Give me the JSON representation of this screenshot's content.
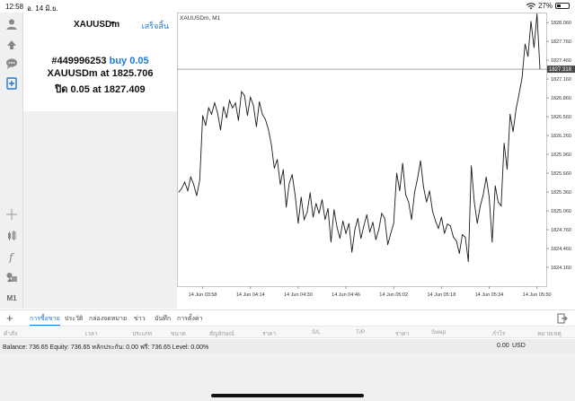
{
  "status_bar": {
    "time": "12:58",
    "date": "อ. 14 มิ.ย.",
    "battery": "27%",
    "battery_level": 0.27
  },
  "toolbar": {
    "icons": [
      "account-icon",
      "trade-icon",
      "chat-icon",
      "new-order-icon",
      "crosshair-icon",
      "indicators-icon",
      "function-icon",
      "objects-icon"
    ],
    "timeframe": "M1"
  },
  "order_panel": {
    "symbol": "XAUUSDm",
    "done_label": "เสร็จสิ้น",
    "ticket": "#449996253",
    "action": "buy 0.05",
    "opened_prefix": "XAUUSDm at",
    "open_price": "1825.706",
    "close_prefix": "ปิด 0.05 at",
    "close_price": "1827.409"
  },
  "chart": {
    "title": "XAUUSDm, M1",
    "current_price": "1827.318",
    "y_labels": [
      "1828.060",
      "1827.760",
      "1827.460",
      "1827.160",
      "1826.860",
      "1826.560",
      "1826.260",
      "1825.960",
      "1825.660",
      "1825.360",
      "1825.060",
      "1824.760",
      "1824.460",
      "1824.160"
    ],
    "x_labels": [
      "14 Jun 03:58",
      "14 Jun 04:14",
      "14 Jun 04:30",
      "14 Jun 04:46",
      "14 Jun 05:02",
      "14 Jun 05:18",
      "14 Jun 05:34",
      "14 Jun 05:50"
    ],
    "line_color": "#1a1a1a",
    "price_line_color": "#8a8a8a"
  },
  "chart_data": {
    "type": "line",
    "title": "XAUUSDm, M1",
    "xlabel": "",
    "ylabel": "",
    "ylim": [
      1823.86,
      1828.22
    ],
    "grid": false,
    "x": [
      "03:50",
      "03:51",
      "03:52",
      "03:53",
      "03:54",
      "03:55",
      "03:56",
      "03:57",
      "03:58",
      "03:59",
      "04:00",
      "04:01",
      "04:02",
      "04:03",
      "04:04",
      "04:05",
      "04:06",
      "04:07",
      "04:08",
      "04:09",
      "04:10",
      "04:11",
      "04:12",
      "04:13",
      "04:14",
      "04:15",
      "04:16",
      "04:17",
      "04:18",
      "04:19",
      "04:20",
      "04:21",
      "04:22",
      "04:23",
      "04:24",
      "04:25",
      "04:26",
      "04:27",
      "04:28",
      "04:29",
      "04:30",
      "04:31",
      "04:32",
      "04:33",
      "04:34",
      "04:35",
      "04:36",
      "04:37",
      "04:38",
      "04:39",
      "04:40",
      "04:41",
      "04:42",
      "04:43",
      "04:44",
      "04:45",
      "04:46",
      "04:47",
      "04:48",
      "04:49",
      "04:50",
      "04:51",
      "04:52",
      "04:53",
      "04:54",
      "04:55",
      "04:56",
      "04:57",
      "04:58",
      "04:59",
      "05:00",
      "05:01",
      "05:02",
      "05:03",
      "05:04",
      "05:05",
      "05:06",
      "05:07",
      "05:08",
      "05:09",
      "05:10",
      "05:11",
      "05:12",
      "05:13",
      "05:14",
      "05:15",
      "05:16",
      "05:17",
      "05:18",
      "05:19",
      "05:20",
      "05:21",
      "05:22",
      "05:23",
      "05:24",
      "05:25",
      "05:26",
      "05:27",
      "05:28",
      "05:29",
      "05:30",
      "05:31",
      "05:32",
      "05:33",
      "05:34",
      "05:35",
      "05:36",
      "05:37",
      "05:38",
      "05:39",
      "05:40",
      "05:41",
      "05:42",
      "05:43",
      "05:44",
      "05:45",
      "05:46",
      "05:47",
      "05:48",
      "05:49",
      "05:50",
      "05:51"
    ],
    "series": [
      {
        "values": [
          1825.36,
          1825.42,
          1825.52,
          1825.38,
          1825.6,
          1825.48,
          1825.3,
          1825.55,
          1826.58,
          1826.42,
          1826.7,
          1826.6,
          1826.78,
          1826.62,
          1826.35,
          1826.72,
          1826.54,
          1826.82,
          1826.7,
          1826.78,
          1826.5,
          1826.96,
          1826.9,
          1826.58,
          1826.87,
          1826.74,
          1826.4,
          1826.8,
          1826.6,
          1826.52,
          1826.36,
          1826.12,
          1825.74,
          1825.88,
          1825.48,
          1825.72,
          1825.12,
          1825.5,
          1825.64,
          1825.3,
          1824.86,
          1825.28,
          1824.92,
          1825.04,
          1825.35,
          1824.96,
          1825.18,
          1825.02,
          1825.24,
          1824.92,
          1825.1,
          1824.56,
          1825.08,
          1824.8,
          1824.62,
          1824.9,
          1824.7,
          1824.86,
          1824.4,
          1824.76,
          1824.94,
          1824.62,
          1824.82,
          1825.0,
          1824.72,
          1824.88,
          1824.6,
          1824.76,
          1825.02,
          1824.94,
          1824.52,
          1824.7,
          1824.86,
          1825.66,
          1825.38,
          1825.82,
          1825.32,
          1825.2,
          1824.92,
          1825.36,
          1825.58,
          1825.86,
          1825.44,
          1825.2,
          1825.38,
          1825.06,
          1824.9,
          1824.78,
          1824.96,
          1824.7,
          1824.85,
          1824.82,
          1824.64,
          1824.58,
          1824.38,
          1824.68,
          1824.64,
          1824.25,
          1825.78,
          1825.2,
          1824.86,
          1825.14,
          1825.32,
          1825.6,
          1825.28,
          1824.56,
          1825.46,
          1825.2,
          1825.14,
          1826.14,
          1825.72,
          1826.6,
          1826.32,
          1826.68,
          1826.92,
          1827.18,
          1827.72,
          1827.52,
          1828.08,
          1827.66,
          1828.2,
          1827.32
        ]
      }
    ]
  },
  "bottom": {
    "tabs": [
      "การซื้อขาย",
      "ประวัติ",
      "กล่องจดหมาย",
      "ข่าว",
      "บันทึก",
      "การตั้งค่า"
    ],
    "columns": [
      "คำสั่ง",
      "เวลา",
      "ประเภท",
      "ขนาด",
      "สัญลักษณ์",
      "ราคา",
      "S/L",
      "T/P",
      "ราคา",
      "Swap",
      "กำไร",
      "หมายเหตุ"
    ],
    "balance_text": "Balance: 736.65 Equity: 736.65 หลักประกัน: 0.00 ฟรี: 736.65 Level: 0.00%",
    "profit": "0.00",
    "currency": "USD"
  }
}
